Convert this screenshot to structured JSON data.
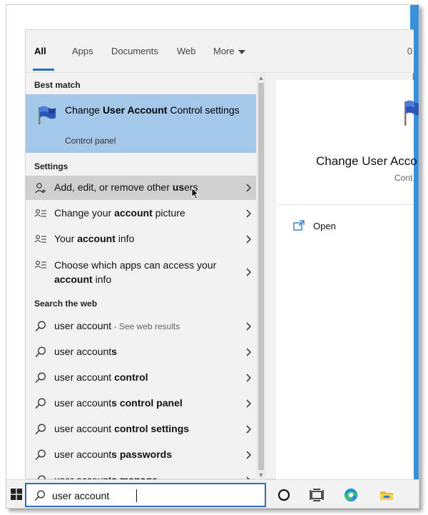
{
  "tabs": {
    "items": [
      {
        "label": "All",
        "active": true
      },
      {
        "label": "Apps"
      },
      {
        "label": "Documents"
      },
      {
        "label": "Web"
      },
      {
        "label": "More"
      }
    ],
    "count": "0"
  },
  "best_match": {
    "header": "Best match",
    "title_pre": "Change ",
    "title_bold": "User Account",
    "title_post": " Control settings",
    "subtitle": "Control panel"
  },
  "settings": {
    "header": "Settings",
    "items": [
      {
        "pre": "Add, edit, or remove other ",
        "bold": "us",
        "post": "ers"
      },
      {
        "pre": "Change your ",
        "bold": "account",
        "post": " picture"
      },
      {
        "pre": "Your ",
        "bold": "account",
        "post": " info"
      },
      {
        "pre": "Choose which apps can access your ",
        "bold": "account",
        "post": " info"
      }
    ]
  },
  "web": {
    "header": "Search the web",
    "items": [
      {
        "pre": "user account",
        "bold": "",
        "post": "",
        "sub": " - See web results"
      },
      {
        "pre": "user account",
        "bold": "s",
        "post": ""
      },
      {
        "pre": "user account ",
        "bold": "control",
        "post": ""
      },
      {
        "pre": "user account",
        "bold": "s control panel",
        "post": ""
      },
      {
        "pre": "user account ",
        "bold": "control settings",
        "post": ""
      },
      {
        "pre": "user account",
        "bold": "s passwords",
        "post": ""
      },
      {
        "pre": "user account",
        "bold": "s manage",
        "post": ""
      }
    ]
  },
  "preview": {
    "title": "Change User Acco",
    "subtitle": "Cont",
    "open_label": "Open"
  },
  "taskbar": {
    "search_value": "user account"
  },
  "colors": {
    "accent": "#2b6cc4",
    "best_match_bg": "#a3c8e8",
    "panel_bg": "#f2f2f2"
  }
}
